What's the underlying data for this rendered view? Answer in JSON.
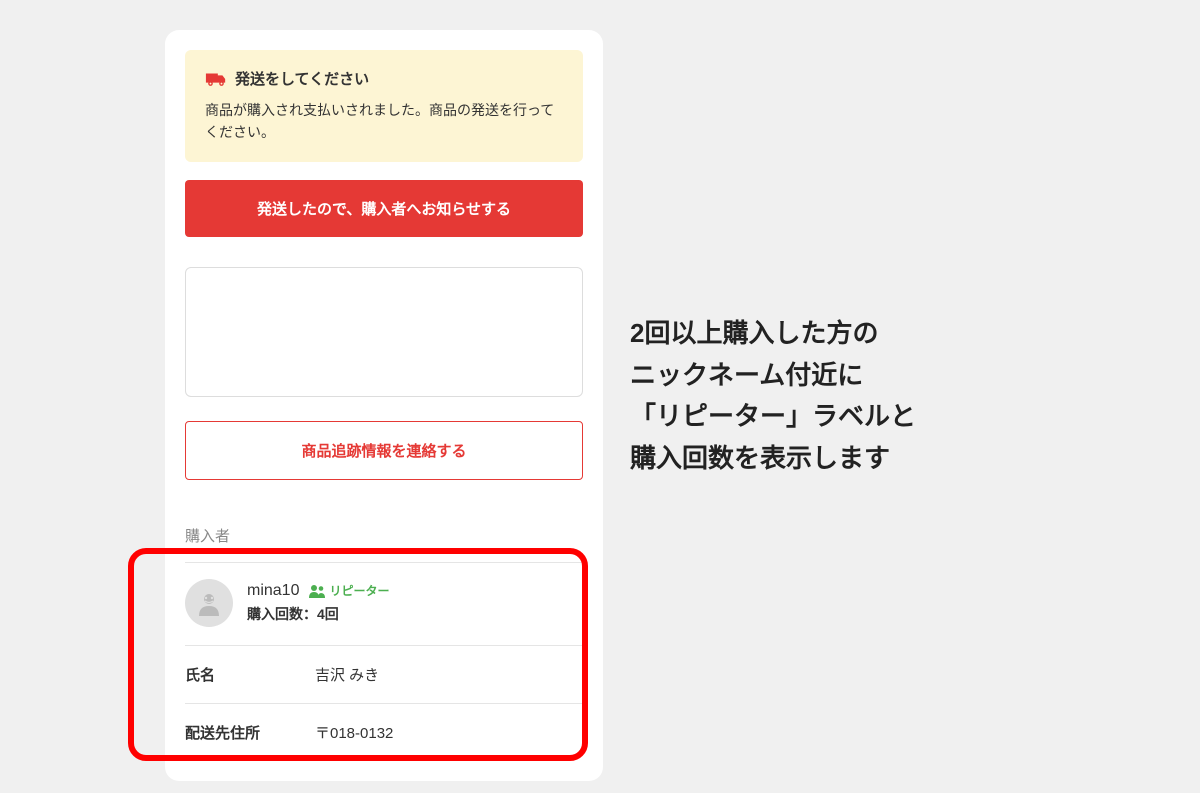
{
  "notice": {
    "title": "発送をしてください",
    "body": "商品が購入され支払いされました。商品の発送を行ってください。"
  },
  "buttons": {
    "notify_shipped": "発送したので、購入者へお知らせする",
    "tracking_info": "商品追跡情報を連絡する"
  },
  "buyer_section": {
    "label": "購入者",
    "nickname": "mina10",
    "repeater_label": "リピーター",
    "purchase_count": "購入回数：4回"
  },
  "info": {
    "name_label": "氏名",
    "name_value": "吉沢 みき",
    "address_label": "配送先住所",
    "address_value": "〒018-0132"
  },
  "annotation": {
    "line1": "2回以上購入した方の",
    "line2": "ニックネーム付近に",
    "line3": "「リピーター」ラベルと",
    "line4": "購入回数を表示します"
  }
}
